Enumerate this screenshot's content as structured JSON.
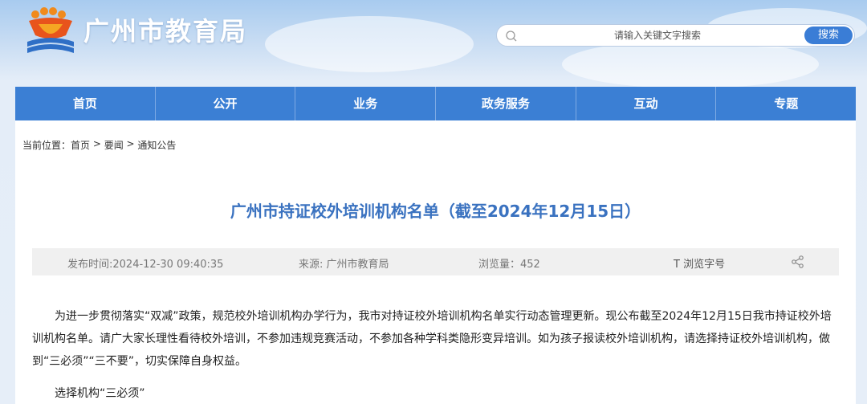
{
  "header": {
    "site_title": "广州市教育局",
    "search": {
      "placeholder": "请输入关键文字搜索",
      "button_label": "搜索"
    }
  },
  "nav": {
    "items": [
      {
        "label": "首页"
      },
      {
        "label": "公开"
      },
      {
        "label": "业务"
      },
      {
        "label": "政务服务"
      },
      {
        "label": "互动"
      },
      {
        "label": "专题"
      }
    ]
  },
  "breadcrumb": {
    "prefix": "当前位置：",
    "items": [
      "首页",
      "要闻",
      "通知公告"
    ],
    "separator": " > "
  },
  "article": {
    "title": "广州市持证校外培训机构名单（截至2024年12月15日）",
    "meta": {
      "publish_time": "发布时间:2024-12-30 09:40:35",
      "source": "来源: 广州市教育局",
      "views": "浏览量：452",
      "font_size_label": "T  浏览字号"
    },
    "paragraph1": "为进一步贯彻落实“双减”政策，规范校外培训机构办学行为，我市对持证校外培训机构名单实行动态管理更新。现公布截至2024年12月15日我市持证校外培训机构名单。请广大家长理性看待校外培训，不参加违规竞赛活动，不参加各种学科类隐形变异培训。如为孩子报读校外培训机构，请选择持证校外培训机构，做到“三必须”“三不要”，切实保障自身权益。",
    "paragraph2": "选择机构“三必须”"
  },
  "colors": {
    "nav_bg": "#3b7fd4",
    "title": "#3a72c0",
    "search_button": "#3a7dd6"
  },
  "icons": [
    "logo-emblem-icon",
    "search-icon",
    "share-icon"
  ]
}
